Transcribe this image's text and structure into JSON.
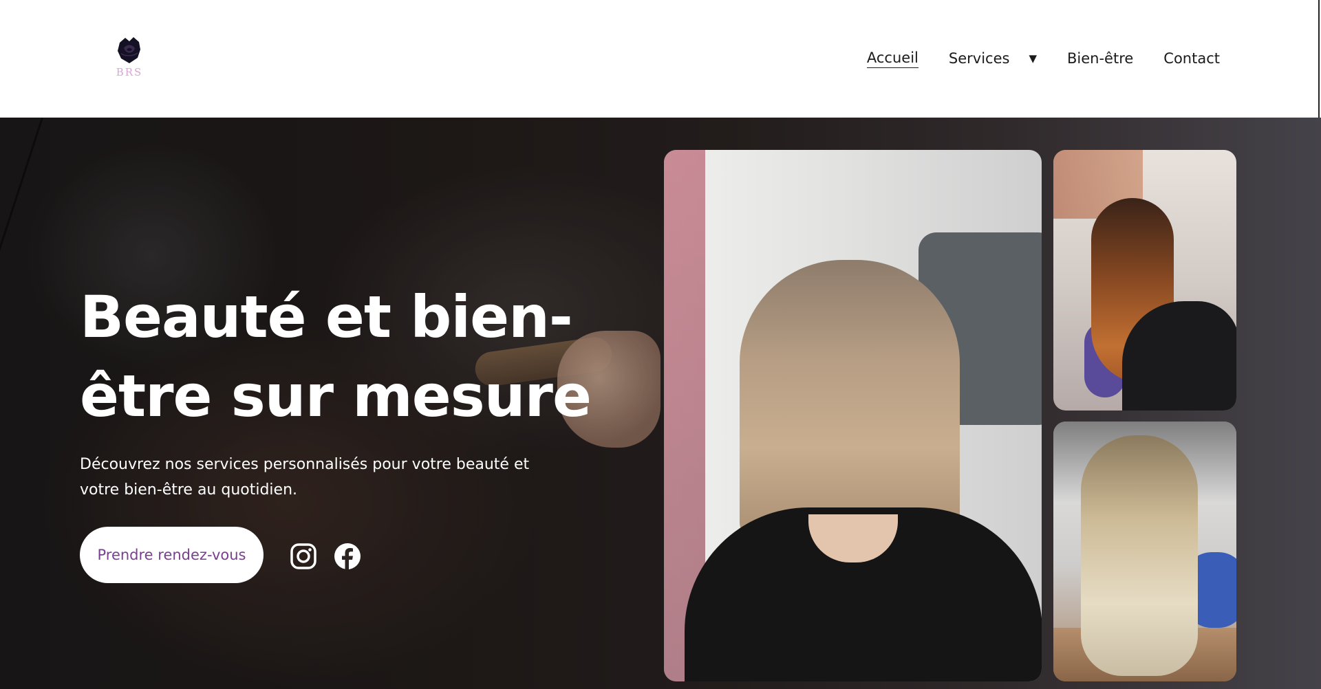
{
  "brand": {
    "logo_text": "BRS",
    "logo_color": "#d9a6d6",
    "logo_icon": "rose-icon"
  },
  "nav": {
    "items": [
      {
        "label": "Accueil",
        "active": true
      },
      {
        "label": "Services",
        "has_dropdown": true
      },
      {
        "label": "Bien-être"
      },
      {
        "label": "Contact"
      }
    ],
    "dropdown_icon": "caret-down-icon"
  },
  "hero": {
    "title": "Beauté et bien-être sur mesure",
    "subtitle": "Découvrez nos services personnalisés pour votre beauté et votre bien-être au quotidien.",
    "cta_label": "Prendre rendez-vous",
    "cta_text_color": "#7a3f8e",
    "social": [
      {
        "icon": "instagram-icon"
      },
      {
        "icon": "facebook-icon"
      }
    ]
  },
  "gallery": {
    "photos": [
      {
        "subject": "short-blonde-bob-haircut-photo"
      },
      {
        "subject": "long-copper-balayage-hair-photo"
      },
      {
        "subject": "long-blonde-curled-hair-photo"
      }
    ]
  }
}
